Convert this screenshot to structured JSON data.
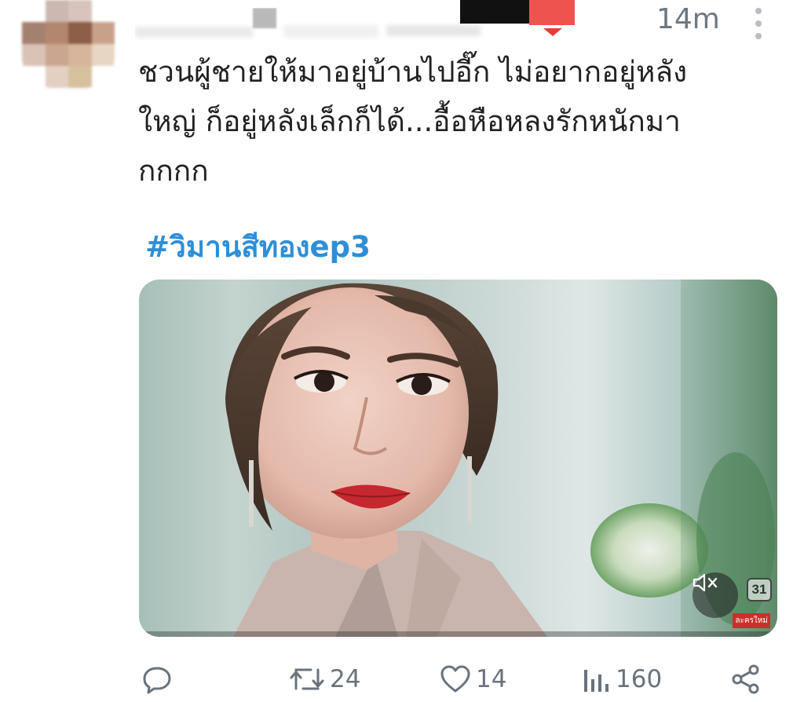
{
  "tweet": {
    "timestamp": "14m",
    "text_lines": [
      "ชวนผู้ชายให้มาอยู่บ้านไปอี๊ก ไม่อยากอยู่หลัง",
      "ใหญ่ ก็อยู่หลังเล็กก็ได้...อื้อหือหลงรักหนักมา",
      "กกกก"
    ],
    "hashtag": "#วิมานสีทองep3",
    "media": {
      "channel_number": "31",
      "channel_tag": "ละครใหม่"
    }
  },
  "actions": {
    "reply": {
      "icon": "reply-icon",
      "count": ""
    },
    "retweet": {
      "icon": "retweet-icon",
      "count": "24"
    },
    "like": {
      "icon": "heart-icon",
      "count": "14"
    },
    "views": {
      "icon": "views-icon",
      "count": "160"
    },
    "share": {
      "icon": "share-icon"
    }
  },
  "colors": {
    "hashtag": "#2d8fd8",
    "text": "#222222",
    "muted": "#69737c",
    "redaction_red": "#ee5350"
  }
}
